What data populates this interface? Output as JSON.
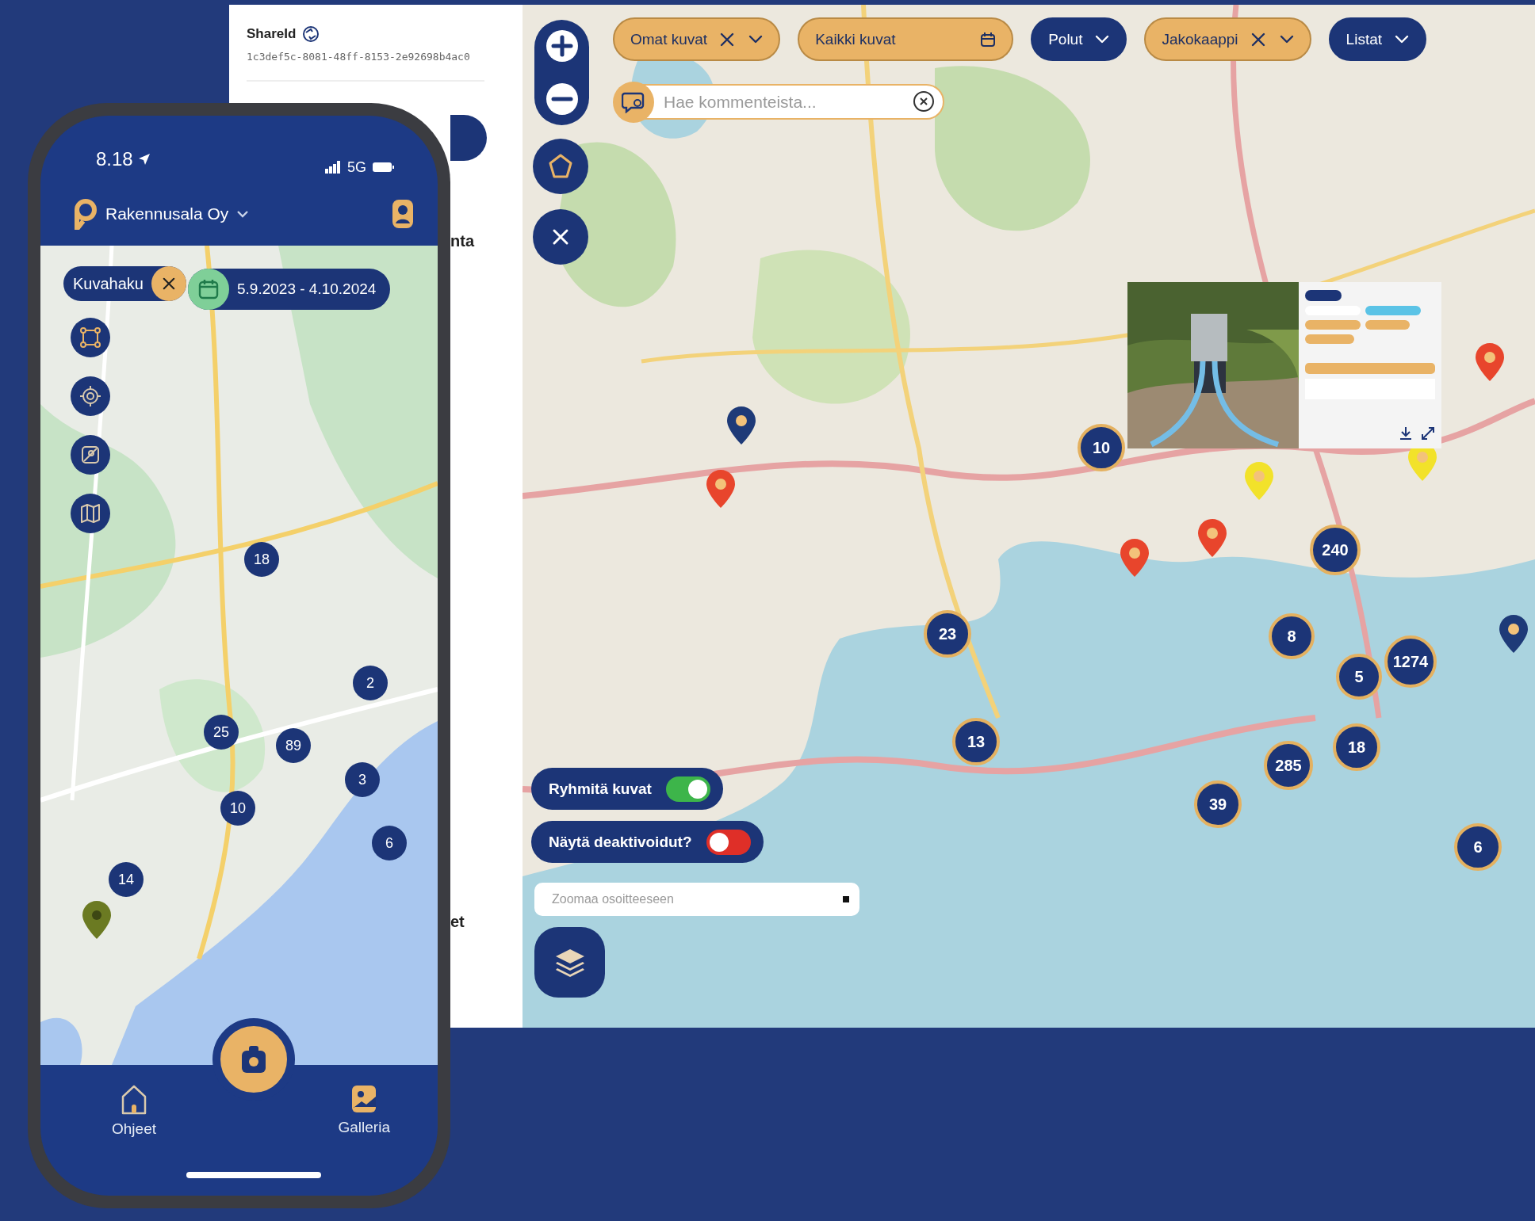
{
  "share_panel": {
    "title": "ShareId",
    "share_id": "1c3def5c-8081-48ff-8153-2e92698b4ac0",
    "cut_texts": [
      "nta",
      "et"
    ]
  },
  "map": {
    "kind": "picture",
    "filters": [
      {
        "label": "Omat kuvat",
        "kind": "dropdown",
        "active": true,
        "clearable": true
      },
      {
        "label": "Kaikki kuvat",
        "kind": "date",
        "active": true,
        "clearable": false
      },
      {
        "label": "Polut",
        "kind": "dropdown",
        "active": false,
        "clearable": false
      },
      {
        "label": "Jakokaappi",
        "kind": "dropdown",
        "active": true,
        "clearable": true
      },
      {
        "label": "Listat",
        "kind": "dropdown",
        "active": false,
        "clearable": false
      }
    ],
    "comment_search": {
      "placeholder": "Hae kommenteista..."
    },
    "toggles": [
      {
        "label": "Ryhmitä kuvat",
        "on": true
      },
      {
        "label": "Näytä deaktivoidut?",
        "on": false
      }
    ],
    "address_search": {
      "placeholder": "Zoomaa osoitteeseen"
    },
    "clusters": [
      {
        "count": "10"
      },
      {
        "count": "23"
      },
      {
        "count": "13"
      },
      {
        "count": "240"
      },
      {
        "count": "8"
      },
      {
        "count": "1274"
      },
      {
        "count": "5"
      },
      {
        "count": "18"
      },
      {
        "count": "285"
      },
      {
        "count": "39"
      },
      {
        "count": "6"
      }
    ],
    "pins": [
      {
        "color": "#1e3a78"
      },
      {
        "color": "#e8452c"
      },
      {
        "color": "#e8452c"
      },
      {
        "color": "#e8452c"
      },
      {
        "color": "#f2e22a"
      },
      {
        "color": "#f2e22a"
      },
      {
        "color": "#e8452c"
      },
      {
        "color": "#1e3a78"
      }
    ]
  },
  "phone": {
    "status": {
      "time": "8.18",
      "network": "5G"
    },
    "header": {
      "company": "Rakennusala Oy"
    },
    "search_chip": {
      "label": "Kuvahaku"
    },
    "date_chip": {
      "label": "5.9.2023 - 4.10.2024"
    },
    "clusters": [
      {
        "count": "18"
      },
      {
        "count": "2"
      },
      {
        "count": "25"
      },
      {
        "count": "89"
      },
      {
        "count": "3"
      },
      {
        "count": "10"
      },
      {
        "count": "6"
      },
      {
        "count": "14"
      }
    ],
    "nav": [
      {
        "kind": "home",
        "label": "Ohjeet"
      },
      {
        "kind": "camera"
      },
      {
        "kind": "gallery",
        "label": "Galleria"
      }
    ]
  }
}
